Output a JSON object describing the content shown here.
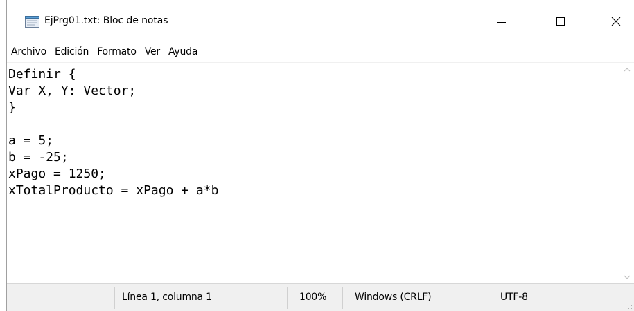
{
  "window": {
    "title": "EjPrg01.txt: Bloc de notas",
    "icon": "notepad-icon",
    "controls": {
      "minimize": "minimize-icon",
      "maximize": "maximize-icon",
      "close": "close-icon"
    }
  },
  "menu": {
    "items": [
      {
        "label": "Archivo"
      },
      {
        "label": "Edición"
      },
      {
        "label": "Formato"
      },
      {
        "label": "Ver"
      },
      {
        "label": "Ayuda"
      }
    ]
  },
  "editor": {
    "lines": [
      "Definir {",
      "Var X, Y: Vector;",
      "}",
      "",
      "a = 5;",
      "b = -25;",
      "xPago = 1250;",
      "xTotalProducto = xPago + a*b"
    ]
  },
  "statusbar": {
    "position": "Línea 1, columna 1",
    "zoom": "100%",
    "line_ending": "Windows (CRLF)",
    "encoding": "UTF-8"
  },
  "colors": {
    "statusbar_bg": "#f0f0f0",
    "text": "#000000",
    "scroll_arrow": "#c0c0c0"
  }
}
